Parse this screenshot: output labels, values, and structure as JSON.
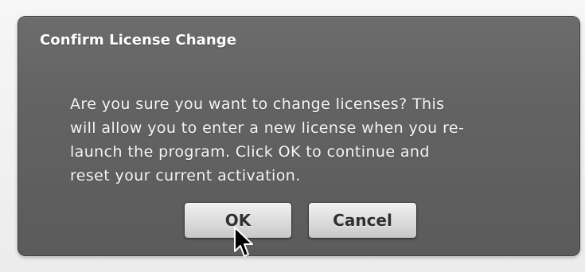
{
  "dialog": {
    "title": "Confirm License Change",
    "message_lines": [
      "Are you sure you want to change licenses?  This",
      "will allow you to enter a new license when you re-",
      "launch the program.  Click OK to continue and",
      "reset your current activation."
    ],
    "buttons": {
      "ok_label": "OK",
      "cancel_label": "Cancel"
    }
  },
  "cursor": {
    "icon": "arrow-cursor-icon"
  },
  "colors": {
    "dialog_background": "#636363",
    "dialog_text": "#ffffff",
    "button_background": "#dddddd",
    "button_text": "#303030",
    "page_background": "#f2f2f2"
  }
}
